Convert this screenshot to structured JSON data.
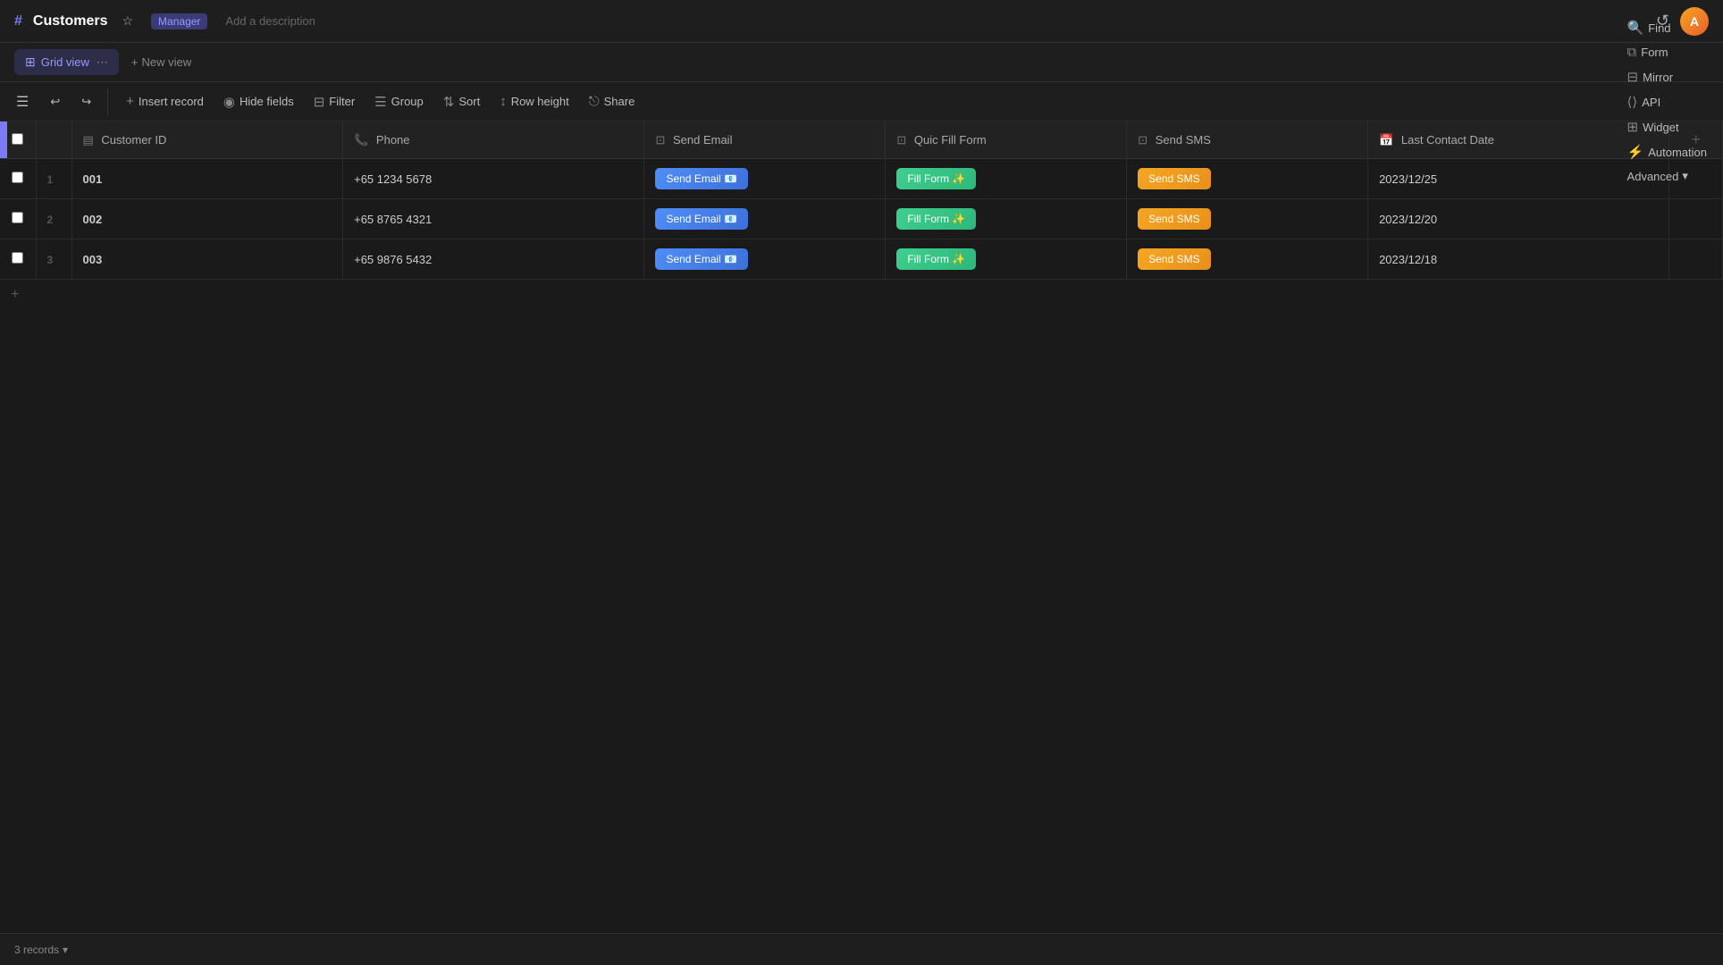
{
  "app": {
    "title": "Customers",
    "badge": "Manager",
    "add_description": "Add a description"
  },
  "toolbar_views": {
    "active_view": "Grid view",
    "active_view_icon": "⊞",
    "new_view_label": "+ New view"
  },
  "toolbar_actions": [
    {
      "id": "insert",
      "label": "Insert record",
      "icon": "+"
    },
    {
      "id": "hide",
      "label": "Hide fields",
      "icon": "◉"
    },
    {
      "id": "filter",
      "label": "Filter",
      "icon": "⊟"
    },
    {
      "id": "group",
      "label": "Group",
      "icon": "☰"
    },
    {
      "id": "sort",
      "label": "Sort",
      "icon": "⇅"
    },
    {
      "id": "row-height",
      "label": "Row height",
      "icon": "↕"
    },
    {
      "id": "share",
      "label": "Share",
      "icon": "⎋"
    },
    {
      "id": "find",
      "label": "Find",
      "icon": "🔍"
    },
    {
      "id": "form",
      "label": "Form",
      "icon": "⧉"
    },
    {
      "id": "mirror",
      "label": "Mirror",
      "icon": "⊟"
    },
    {
      "id": "api",
      "label": "API",
      "icon": "⟨⟩"
    },
    {
      "id": "widget",
      "label": "Widget",
      "icon": "⊞"
    },
    {
      "id": "automation",
      "label": "Automation",
      "icon": "⚡"
    },
    {
      "id": "advanced",
      "label": "Advanced",
      "icon": "▾"
    }
  ],
  "columns": [
    {
      "id": "customer-id",
      "label": "Customer ID",
      "icon": "▤",
      "type": "id"
    },
    {
      "id": "phone",
      "label": "Phone",
      "icon": "📞",
      "type": "phone"
    },
    {
      "id": "send-email",
      "label": "Send Email",
      "icon": "⊡",
      "type": "button"
    },
    {
      "id": "fill-form",
      "label": "Quic Fill Form",
      "icon": "⊡",
      "type": "button"
    },
    {
      "id": "send-sms",
      "label": "Send SMS",
      "icon": "⊡",
      "type": "button"
    },
    {
      "id": "last-contact",
      "label": "Last Contact Date",
      "icon": "📅",
      "type": "date"
    }
  ],
  "rows": [
    {
      "row_num": 1,
      "customer_id": "001",
      "phone": "+65 1234 5678",
      "send_email_label": "Send Email 📧",
      "fill_form_label": "Fill Form ✨",
      "send_sms_label": "Send SMS",
      "last_contact": "2023/12/25"
    },
    {
      "row_num": 2,
      "customer_id": "002",
      "phone": "+65 8765 4321",
      "send_email_label": "Send Email 📧",
      "fill_form_label": "Fill Form ✨",
      "send_sms_label": "Send SMS",
      "last_contact": "2023/12/20"
    },
    {
      "row_num": 3,
      "customer_id": "003",
      "phone": "+65 9876 5432",
      "send_email_label": "Send Email 📧",
      "fill_form_label": "Fill Form ✨",
      "send_sms_label": "Send SMS",
      "last_contact": "2023/12/18"
    }
  ],
  "footer": {
    "records_count": "3 records",
    "dropdown_icon": "▾"
  }
}
